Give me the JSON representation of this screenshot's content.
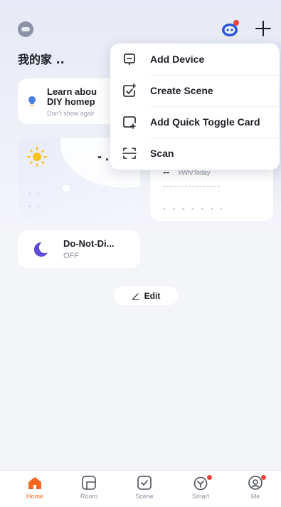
{
  "header": {
    "home_title": "我的家 ..",
    "avatar_icon": "robot-face-icon",
    "assistant_icon": "assistant-bot-icon",
    "add_icon": "plus-icon"
  },
  "add_menu": {
    "items": [
      {
        "label": "Add Device",
        "icon": "add-device-icon"
      },
      {
        "label": "Create Scene",
        "icon": "create-scene-icon"
      },
      {
        "label": "Add Quick Toggle Card",
        "icon": "add-card-icon"
      },
      {
        "label": "Scan",
        "icon": "scan-icon"
      }
    ]
  },
  "tip_card": {
    "title_line1": "Learn abou",
    "title_line2": "DIY homep",
    "subtitle": "Don't show agair",
    "icon": "lightbulb-icon"
  },
  "weather_card": {
    "icon": "sun-icon",
    "temperature": "- .",
    "line1": "- -",
    "line2": "- -"
  },
  "energy_card": {
    "value": "--",
    "unit": "kWh/Today",
    "placeholder": "- - - - - - -"
  },
  "dnd_card": {
    "title": "Do-Not-Di...",
    "status": "OFF",
    "icon": "moon-icon"
  },
  "edit_button": {
    "label": "Edit",
    "icon": "pencil-icon"
  },
  "tabbar": {
    "tabs": [
      {
        "label": "Home",
        "icon": "home-icon",
        "active": true
      },
      {
        "label": "Room",
        "icon": "room-icon",
        "active": false
      },
      {
        "label": "Scene",
        "icon": "scene-icon",
        "active": false
      },
      {
        "label": "Smart",
        "icon": "smart-icon",
        "active": false
      },
      {
        "label": "Me",
        "icon": "profile-icon",
        "active": false
      }
    ]
  },
  "colors": {
    "accent": "#f4681f",
    "badge": "#e8453c",
    "moon": "#5b4bd6",
    "bulb": "#4f7de8",
    "sun": "#f7c21b"
  }
}
